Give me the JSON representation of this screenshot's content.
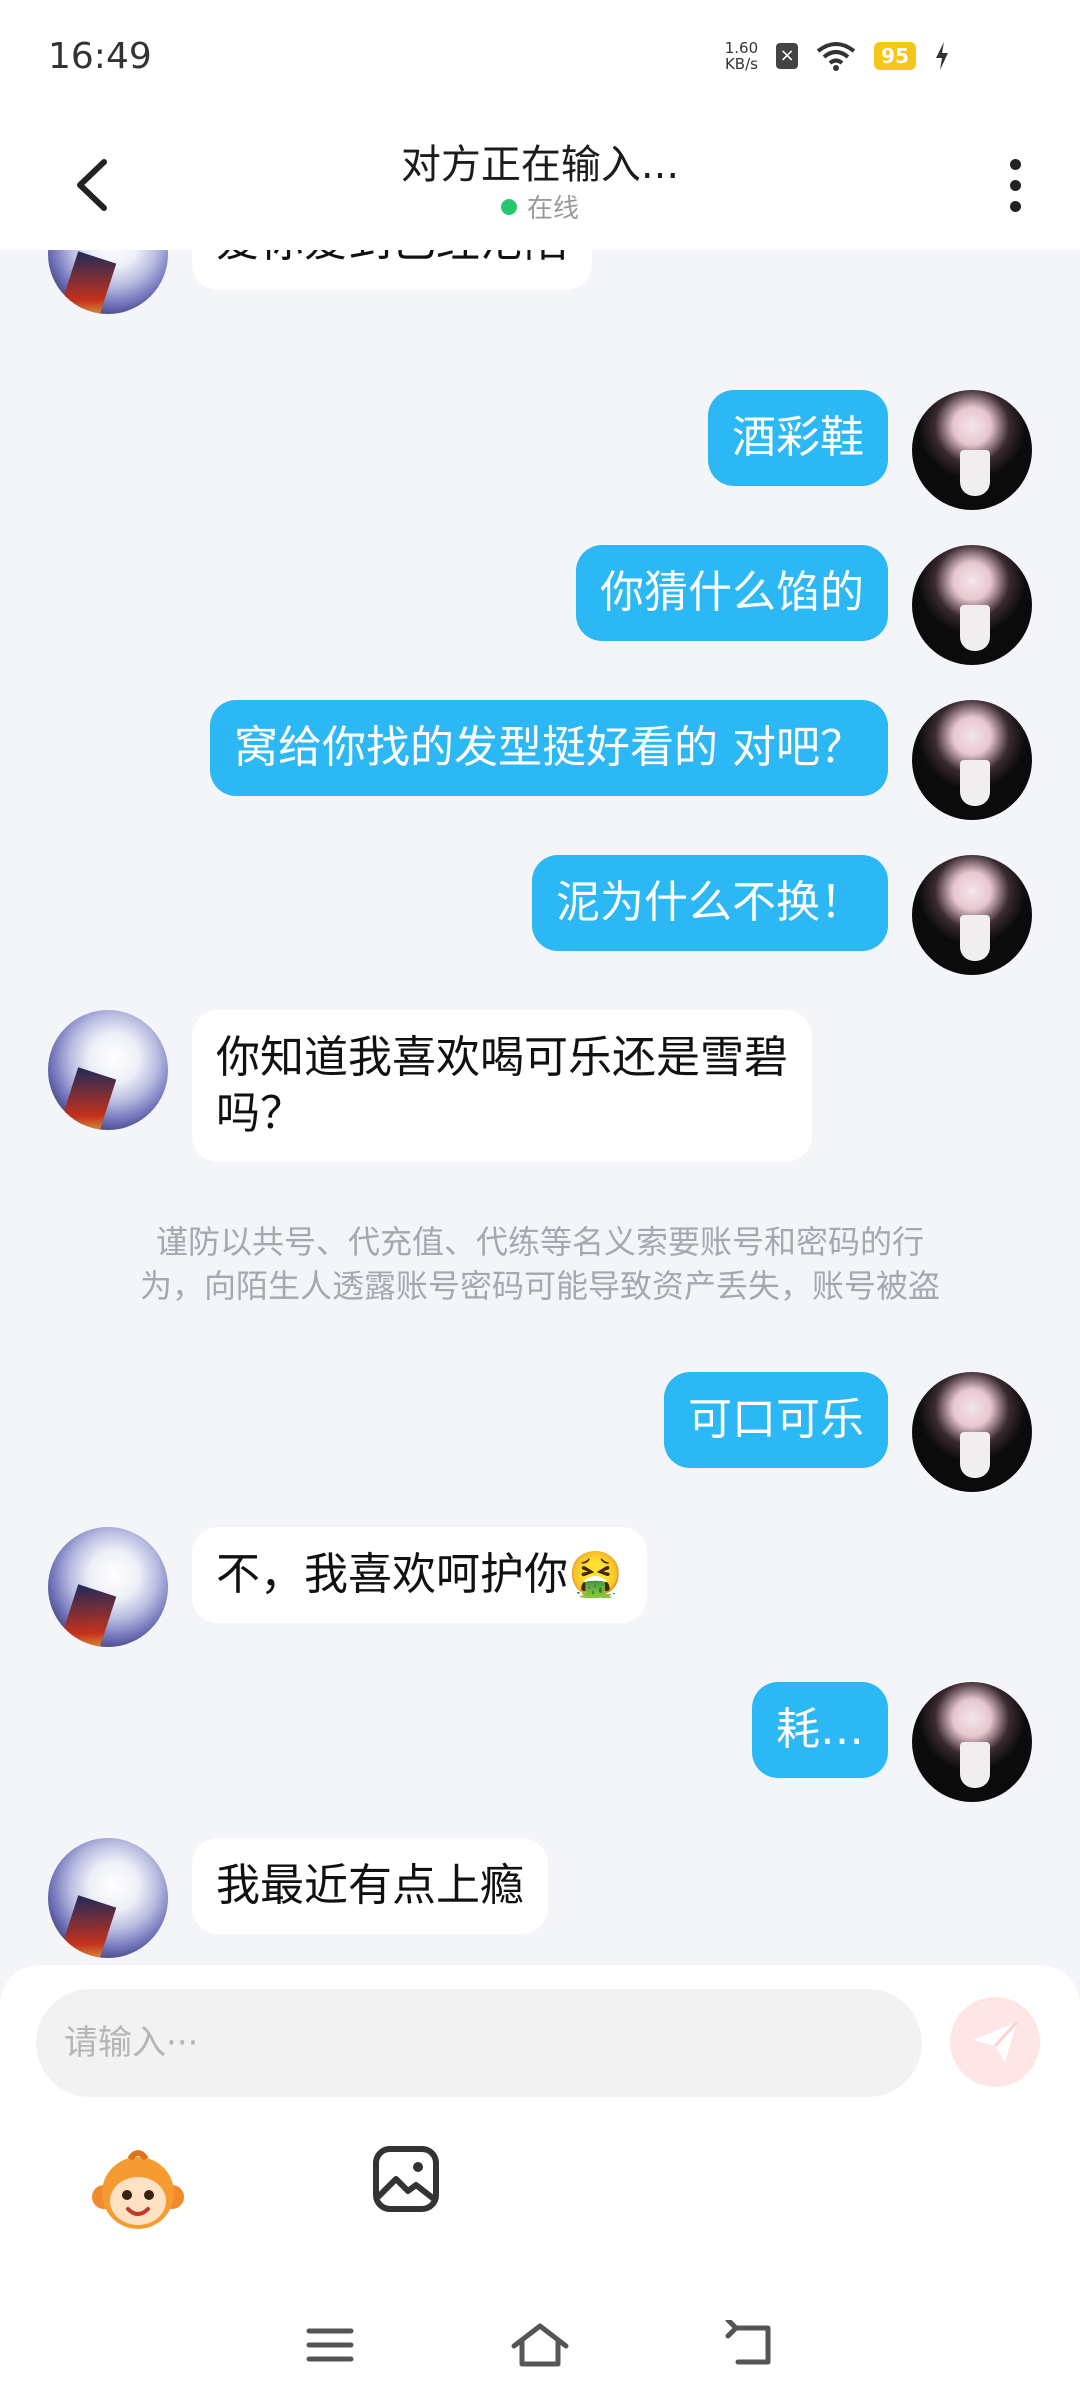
{
  "status_bar": {
    "time": "16:49",
    "net_speed_value": "1.60",
    "net_speed_unit": "KB/s",
    "battery": "95"
  },
  "header": {
    "title": "对方正在输入...",
    "status": "在线"
  },
  "messages": [
    {
      "side": "in",
      "text": "爱你爱到已经沦陷"
    },
    {
      "side": "out",
      "text": "酒彩鞋"
    },
    {
      "side": "out",
      "text": "你猜什么馅的"
    },
    {
      "side": "out",
      "text": "窝给你找的发型挺好看的 对吧？"
    },
    {
      "side": "out",
      "text": "泥为什么不换！"
    },
    {
      "side": "in",
      "text_line1": "你知道我喜欢喝可乐还是雪碧",
      "text_line2": "吗？"
    },
    {
      "side": "out",
      "text": "可口可乐"
    },
    {
      "side": "in",
      "text": "不，我喜欢呵护你🤮"
    },
    {
      "side": "out",
      "text": "耗…"
    },
    {
      "side": "in",
      "text": "我最近有点上瘾"
    }
  ],
  "notice": {
    "line1": "谨防以共号、代充值、代练等名义索要账号和密码的行",
    "line2": "为，向陌生人透露账号密码可能导致资产丢失，账号被盗"
  },
  "composer": {
    "placeholder": "请输入···"
  },
  "colors": {
    "outgoing_bubble": "#2cb7f5",
    "incoming_bubble": "#ffffff",
    "background": "#f4f5f9",
    "online_dot": "#28c76f",
    "send_button": "#ffe6e6"
  },
  "icons": [
    "back-arrow-icon",
    "more-vert-icon",
    "send-icon",
    "monkey-emoji-icon",
    "image-icon",
    "menu-icon",
    "home-icon",
    "back-nav-icon"
  ]
}
